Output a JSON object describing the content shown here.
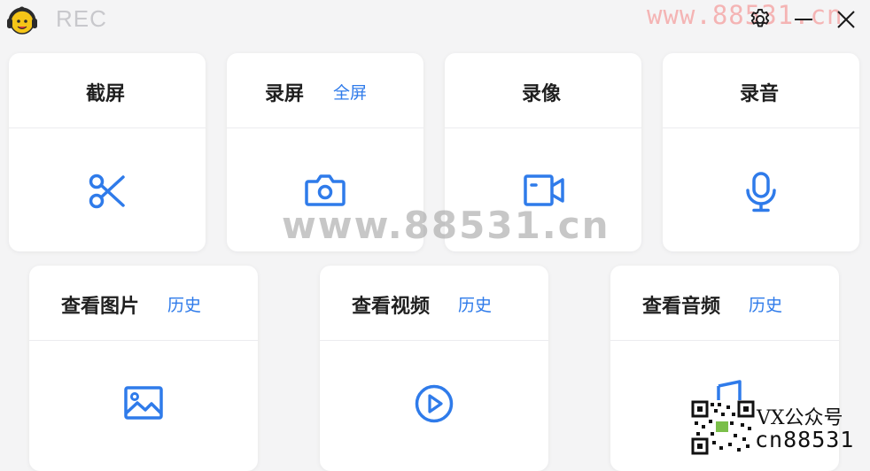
{
  "app": {
    "title": "REC"
  },
  "watermark": {
    "top": "www.88531.cn",
    "center": "www.88531.cn"
  },
  "titlebar": {
    "settings_icon": "gear-icon",
    "minimize_icon": "minimize-icon",
    "close_icon": "close-icon"
  },
  "cards": [
    {
      "title": "截屏",
      "link": "",
      "icon": "scissors-icon"
    },
    {
      "title": "录屏",
      "link": "全屏",
      "icon": "camera-icon"
    },
    {
      "title": "录像",
      "link": "",
      "icon": "video-camera-icon"
    },
    {
      "title": "录音",
      "link": "",
      "icon": "microphone-icon"
    },
    {
      "title": "查看图片",
      "link": "历史",
      "icon": "image-icon"
    },
    {
      "title": "查看视频",
      "link": "历史",
      "icon": "play-circle-icon"
    },
    {
      "title": "查看音频",
      "link": "历史",
      "icon": "music-note-icon"
    }
  ],
  "overlay": {
    "line1": "VX公众号",
    "line2": "cn88531"
  },
  "colors": {
    "accent": "#2f7bea",
    "background": "#f4f4f5",
    "card": "#ffffff",
    "title_text": "#1f1f1f"
  }
}
